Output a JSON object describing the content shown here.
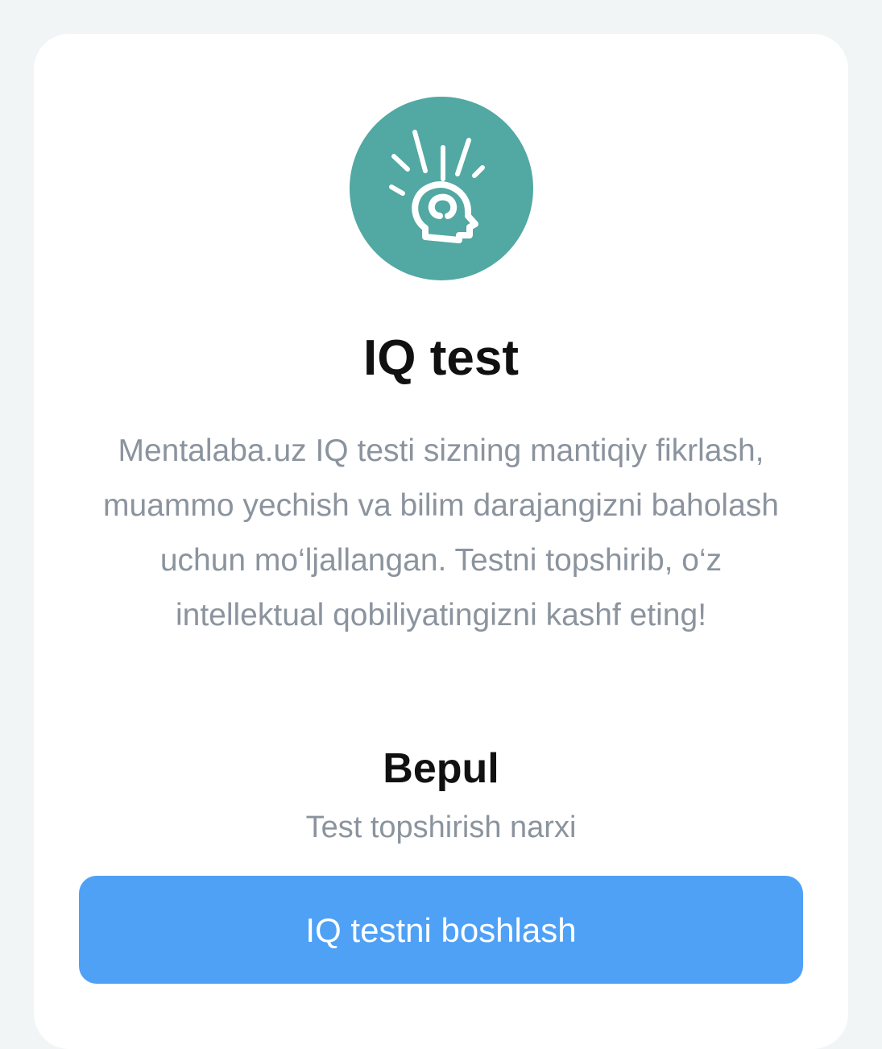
{
  "test_card": {
    "icon": "brain-head-icon",
    "icon_color": "#52a8a2",
    "title": "IQ test",
    "description": "Mentalaba.uz IQ testi sizning mantiqiy fikrlash, muammo yechish va bilim darajangizni baholash uchun mo‘ljallangan. Testni topshirib, o‘z intellektual qobiliyatingizni kashf eting!",
    "price": "Bepul",
    "price_caption": "Test topshirish narxi",
    "start_button_label": "IQ testni boshlash",
    "button_color": "#4fa1f6"
  }
}
